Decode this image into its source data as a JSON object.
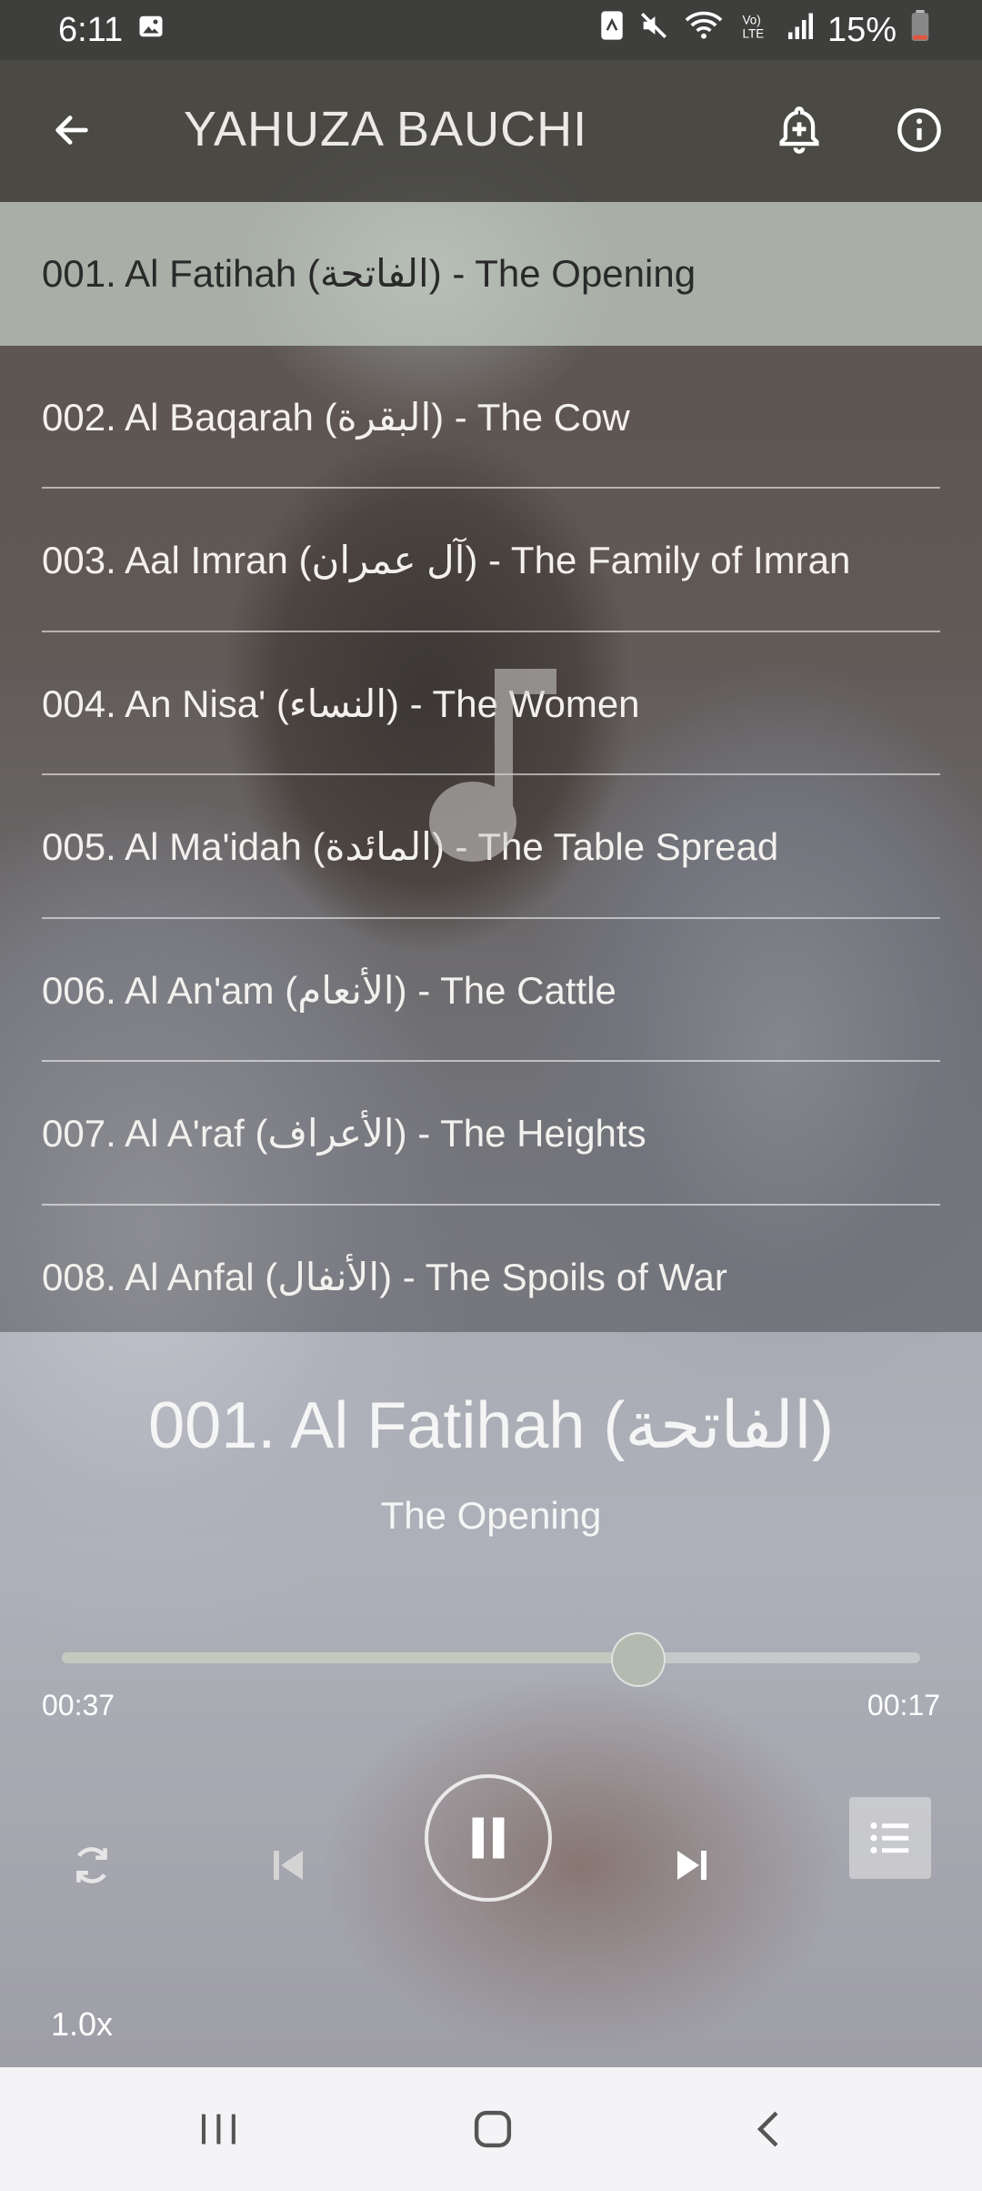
{
  "status_bar": {
    "time": "6:11",
    "battery": "15%",
    "icons": [
      "image-icon",
      "nfc-icon",
      "mute-icon",
      "wifi-icon",
      "volte-icon",
      "signal-icon",
      "battery-icon"
    ]
  },
  "app_bar": {
    "title": "YAHUZA BAUCHI",
    "icons": [
      "back-arrow-icon",
      "alarm-add-icon",
      "info-icon"
    ]
  },
  "list": {
    "items": [
      {
        "label": "001. Al Fatihah (الفاتحة) - The Opening",
        "active": true
      },
      {
        "label": "002. Al Baqarah (البقرة) - The Cow",
        "active": false
      },
      {
        "label": "003. Aal Imran (آل عمران) - The Family of Imran",
        "active": false
      },
      {
        "label": "004. An Nisa' (النساء) - The Women",
        "active": false
      },
      {
        "label": "005. Al Ma'idah (المائدة) - The Table Spread",
        "active": false
      },
      {
        "label": "006. Al An'am (الأنعام) - The Cattle",
        "active": false
      },
      {
        "label": "007. Al A'raf (الأعراف) - The Heights",
        "active": false
      },
      {
        "label": "008. Al Anfal (الأنفال) - The Spoils of War",
        "active": false
      }
    ]
  },
  "player": {
    "title": "001. Al Fatihah (الفاتحة)",
    "subtitle": "The Opening",
    "elapsed": "00:37",
    "remaining": "00:17",
    "progress": 0.67,
    "speed": "1.0x",
    "state": "playing",
    "icons": [
      "repeat-icon",
      "previous-icon",
      "pause-icon",
      "next-icon",
      "queue-list-icon"
    ]
  },
  "colors": {
    "status_bar": "#3e3e3c",
    "app_bar": "#464642",
    "active_item": "#c3cdc3",
    "nav_bar": "#f4f4f6"
  }
}
